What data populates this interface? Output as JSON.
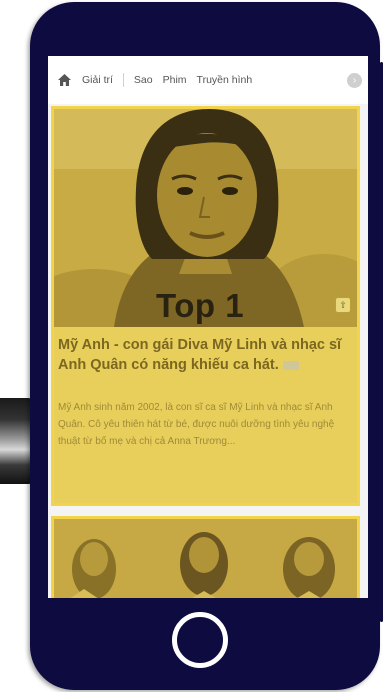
{
  "nav": {
    "items": [
      "Giải trí",
      "Sao",
      "Phim",
      "Truyền hình"
    ]
  },
  "article": {
    "badge": "Top 1",
    "title": "Mỹ Anh - con gái Diva Mỹ Linh và nhạc sĩ Anh Quân có năng khiếu ca hát.",
    "description": "Mỹ Anh sinh năm 2002, là con sĩ ca sĩ Mỹ Linh và nhạc sĩ Anh Quân. Cô yêu thiên hát từ bé, được nuôi dưỡng tình yêu nghệ thuật từ bố mẹ và chị cả Anna Trương..."
  },
  "colors": {
    "bezel": "#0d0b40",
    "highlight": "#f1d44b",
    "card_fill": "#e8cf5c",
    "title_text": "#7b6720"
  },
  "icons": {
    "home": "home-icon",
    "more": "chevron-right-icon",
    "home_button": "home-button-ring"
  }
}
